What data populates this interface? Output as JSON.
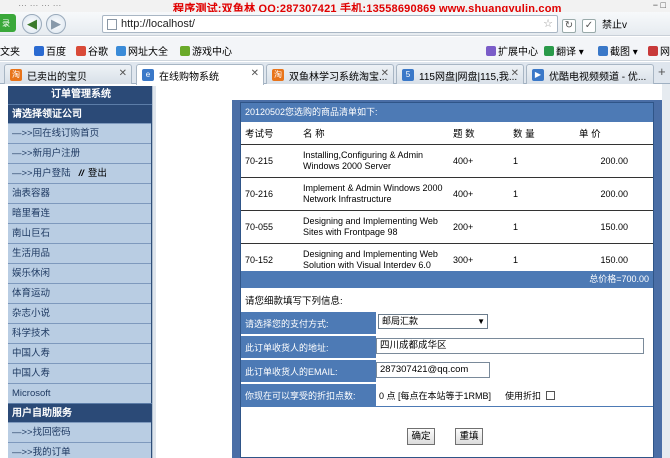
{
  "window": {
    "ghost_title": "… … … …",
    "watermark": "程序测试:双鱼林 QQ:287307421 手机:13558690869 www.shuangyulin.com",
    "right_ctl": "− □"
  },
  "navbar": {
    "green_badge": "录",
    "back_glyph": "◀",
    "forward_glyph": "▶",
    "url": "http://localhost/",
    "star": "☆",
    "right_icon": "↻",
    "right_icon2": "✓",
    "right_text": "禁止v"
  },
  "bookmarks": {
    "items": [
      "文夹",
      "百度",
      "谷歌",
      "网址大全",
      "游戏中心"
    ],
    "right_items": [
      "扩展中心",
      "翻译 ▾",
      "截图 ▾",
      "网银"
    ]
  },
  "tabs": [
    {
      "label": "已卖出的宝贝",
      "color": "#e8741a",
      "icon": "淘"
    },
    {
      "label": "在线购物系统",
      "color": "#3a78c8",
      "icon": "e"
    },
    {
      "label": "双鱼林学习系统淘宝...",
      "color": "#e8741a",
      "icon": "淘"
    },
    {
      "label": "115网盘|网盘|115,我...",
      "color": "#3a78c8",
      "icon": "5"
    },
    {
      "label": "优酷电视频频道 - 优...",
      "color": "#3a78c8",
      "icon": "▶"
    }
  ],
  "tab_close": "✕",
  "new_tab": "+",
  "sidebar": {
    "title": "订单管理系统",
    "section1": "请选择领证公司",
    "items": [
      {
        "label": "—>>回在线订购首页"
      },
      {
        "label": "—>>新用户注册"
      },
      {
        "label": "—>>用户登陆",
        "sep": "//",
        "extra": "登出"
      },
      {
        "label": "油表容器"
      },
      {
        "label": "暗里看连"
      },
      {
        "label": "南山巨石"
      },
      {
        "label": "生活用品"
      },
      {
        "label": "娱乐休闲"
      },
      {
        "label": "体育运动"
      },
      {
        "label": "杂志小说"
      },
      {
        "label": "科学技术"
      },
      {
        "label": "中国人寿"
      },
      {
        "label": "中国人寿"
      },
      {
        "label": "Microsoft"
      }
    ],
    "section2": "用户自助服务",
    "items2": [
      {
        "label": "—>>找回密码"
      },
      {
        "label": "—>>我的订单"
      }
    ]
  },
  "order": {
    "header": "20120502您选购的商品清单如下:",
    "columns": [
      "考试号",
      "名 称",
      "题 数",
      "数 量",
      "单 价"
    ],
    "rows": [
      {
        "code": "70-215",
        "name": "Installing,Configuring & Admin Windows 2000 Server",
        "count": "400+",
        "qty": "1",
        "price": "200.00"
      },
      {
        "code": "70-216",
        "name": "Implement & Admin Windows 2000 Network Infrastructure",
        "count": "400+",
        "qty": "1",
        "price": "200.00"
      },
      {
        "code": "70-055",
        "name": "Designing and Implementing Web Sites with Frontpage 98",
        "count": "200+",
        "qty": "1",
        "price": "150.00"
      },
      {
        "code": "70-152",
        "name": "Designing and Implementing Web Solution with Visual Interdev 6.0",
        "count": "300+",
        "qty": "1",
        "price": "150.00"
      }
    ],
    "total": "总价格=700.00"
  },
  "form": {
    "note": "请您细款填写下列信息:",
    "pay_label": "请选择您的支付方式:",
    "pay_value": "邮局汇款",
    "addr_label": "此订单收货人的地址:",
    "addr_value": "四川成都成华区",
    "email_label": "此订单收货人的EMAIL:",
    "email_value": "287307421@qq.com",
    "discount_label": "你现在可以享受的折扣点数:",
    "discount_text": "0 点 [每点在本站等于1RMB]",
    "use_discount": "使用折扣",
    "confirm": "确定",
    "reset": "重填"
  }
}
